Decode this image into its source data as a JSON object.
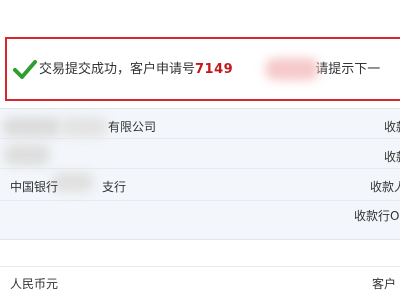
{
  "notice": {
    "message_prefix": "交易提交成功，客户申请号",
    "application_number_visible": "7149",
    "message_suffix": "请提示下一"
  },
  "details": {
    "row1_left": "有限公司",
    "row1_right": "收款",
    "row2_right": "收款",
    "row3_left_a": "中国银行",
    "row3_left_b": "支行",
    "row3_right": "收款人",
    "row4_right": "收款行O"
  },
  "footer": {
    "currency": "人民币元",
    "right_label": "客户"
  },
  "colors": {
    "border": "#d9262e",
    "check": "#2e9e2e",
    "application_number": "#c4161c",
    "panel_bg": "#f3f6fa"
  }
}
